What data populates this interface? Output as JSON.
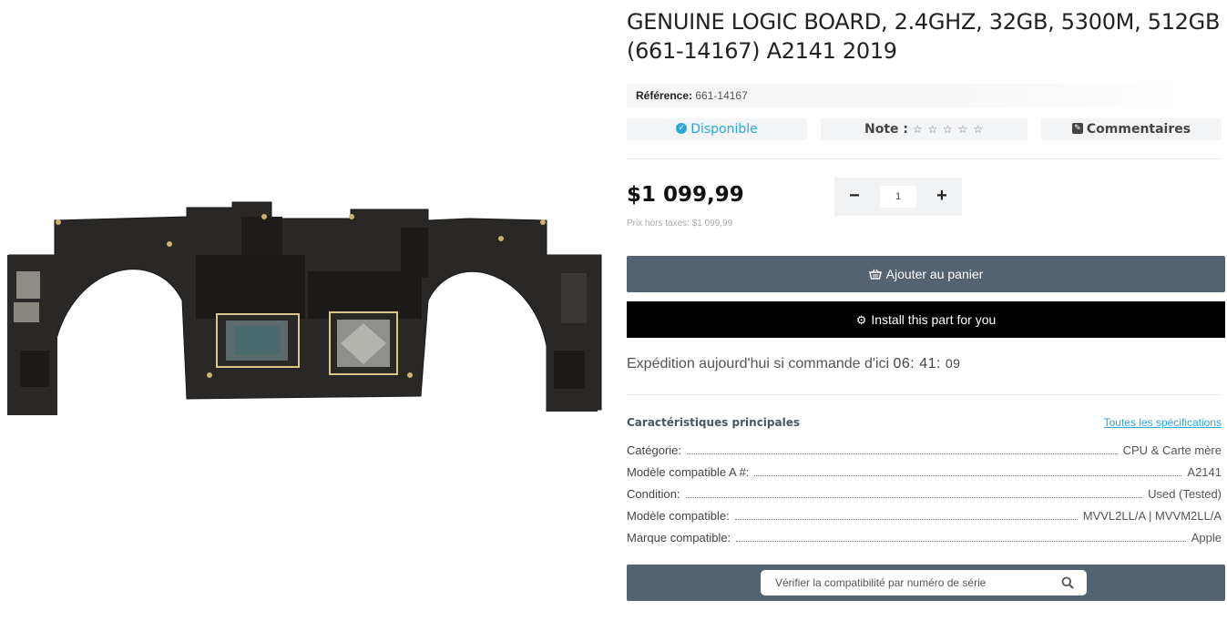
{
  "product": {
    "title_line1": "GENUINE LOGIC BOARD, 2.4GHZ, 32GB, 5300M, 512GB",
    "title_line2": "(661-14167) A2141 2019",
    "reference_label": "Référence:",
    "reference_value": "661-14167",
    "image_icon": "logic-board-photo"
  },
  "status": {
    "availability": "Disponible",
    "availability_icon": "check-circle-icon",
    "note_label": "Note :",
    "rating_stars": "☆ ☆ ☆ ☆ ☆",
    "rating_value": 0,
    "rating_max": 5,
    "comments_label": "Commentaires",
    "comments_icon": "edit-icon"
  },
  "pricing": {
    "price": "$1 099,99",
    "price_excl_tax": "Prix hors taxes: $1 099,99"
  },
  "quantity": {
    "minus": "−",
    "value": "1",
    "plus": "+"
  },
  "actions": {
    "add_to_cart": "Ajouter au panier",
    "add_to_cart_icon": "basket-icon",
    "install": "Install this part for you",
    "install_icon": "gear-icon"
  },
  "shipping": {
    "text": "Expédition aujourd'hui si commande d'ici",
    "hours": "06",
    "minutes": "41",
    "seconds": "09"
  },
  "specs": {
    "title": "Caractéristiques principales",
    "all_link": "Toutes les spécifications",
    "rows": [
      {
        "label": "Catégorie:",
        "value": "CPU & Carte mère"
      },
      {
        "label": "Modèle compatible A #:",
        "value": "A2141"
      },
      {
        "label": "Condition:",
        "value": "Used (Tested)"
      },
      {
        "label": "Modèle compatible:",
        "value": "MVVL2LL/A | MVVM2LL/A"
      },
      {
        "label": "Marque compatible:",
        "value": "Apple"
      }
    ]
  },
  "serial_check": {
    "placeholder": "Vérifier la compatibilité par numéro de série",
    "icon": "search-icon"
  },
  "colors": {
    "accent_blue": "#2ba7dc",
    "button_slate": "#546371",
    "button_black": "#000000"
  }
}
